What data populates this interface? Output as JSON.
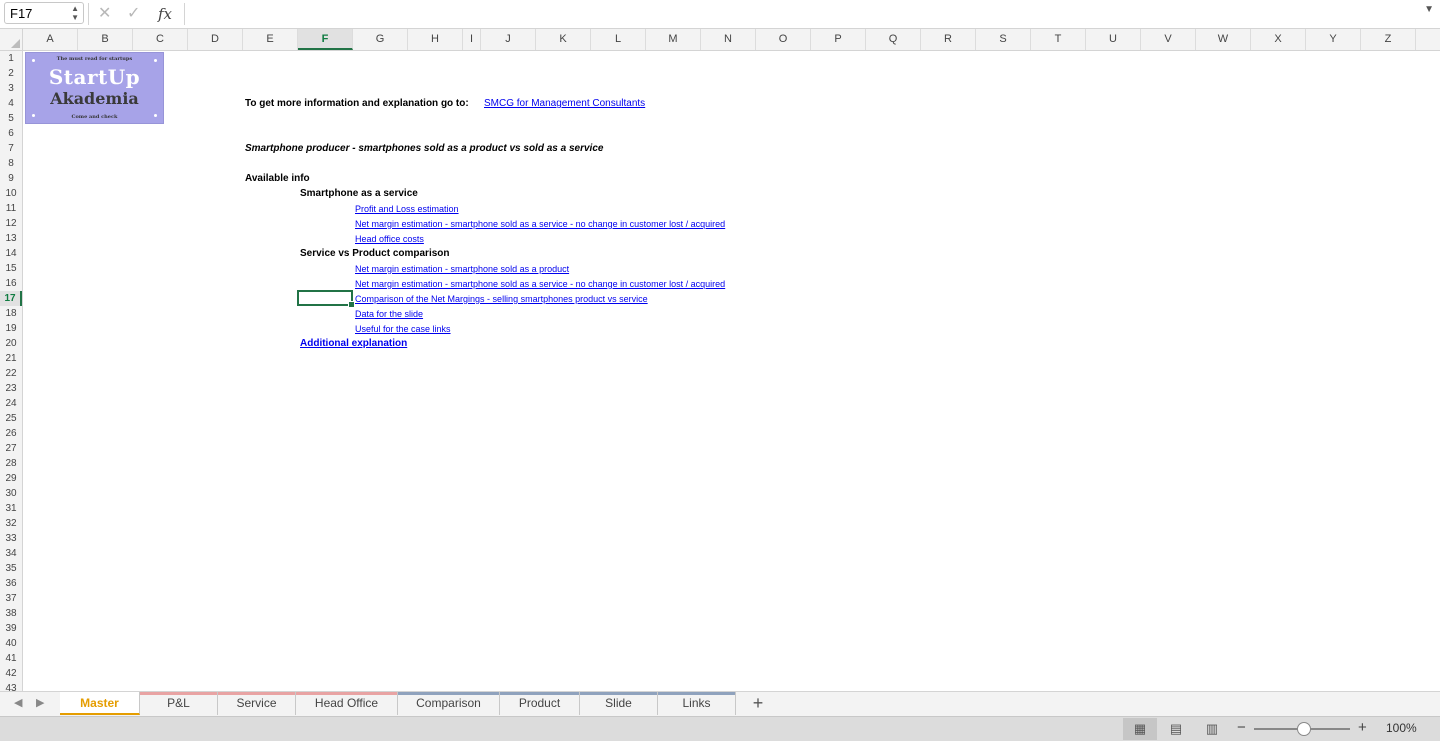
{
  "formula_bar": {
    "name_box": "F17",
    "fx_label": "fx",
    "formula": ""
  },
  "columns": [
    "A",
    "B",
    "C",
    "D",
    "E",
    "F",
    "G",
    "H",
    "I",
    "J",
    "K",
    "L",
    "M",
    "N",
    "O",
    "P",
    "Q",
    "R",
    "S",
    "T",
    "U",
    "V",
    "W",
    "X",
    "Y",
    "Z"
  ],
  "active_column": "F",
  "active_row": 17,
  "row_count": 43,
  "logo": {
    "tagline_top": "The must read for startups",
    "line1": "StartUp",
    "line2": "Akademia",
    "tagline_bottom": "Come and check"
  },
  "cells": {
    "intro_text": "To get more information and explanation go to:",
    "intro_link": "SMCG for Management Consultants",
    "subtitle": "Smartphone producer - smartphones sold as a product vs sold as a service",
    "available_info": "Available info",
    "section1": "Smartphone as a service",
    "section1_links": [
      "Profit and Loss estimation",
      "Net margin estimation - smartphone sold as a service - no change in customer lost / acquired",
      "Head office costs"
    ],
    "section2": "Service vs Product comparison",
    "section2_links": [
      "Net margin estimation - smartphone sold as a product",
      "Net margin estimation - smartphone sold as a service - no change in customer lost / acquired",
      "Comparison of the Net Margings - selling smartphones product vs service",
      "Data for the slide",
      "Useful for the case links"
    ],
    "additional": "Additional explanation"
  },
  "tabs": [
    {
      "label": "Master",
      "color": "#e59d00",
      "active": true
    },
    {
      "label": "P&L",
      "color": "#e8a3a3",
      "active": false
    },
    {
      "label": "Service",
      "color": "#e8a3a3",
      "active": false
    },
    {
      "label": "Head Office",
      "color": "#e8a3a3",
      "active": false
    },
    {
      "label": "Comparison",
      "color": "#8fa2bd",
      "active": false
    },
    {
      "label": "Product",
      "color": "#8fa2bd",
      "active": false
    },
    {
      "label": "Slide",
      "color": "#8fa2bd",
      "active": false
    },
    {
      "label": "Links",
      "color": "#8fa2bd",
      "active": false
    }
  ],
  "status": {
    "zoom": "100%"
  }
}
